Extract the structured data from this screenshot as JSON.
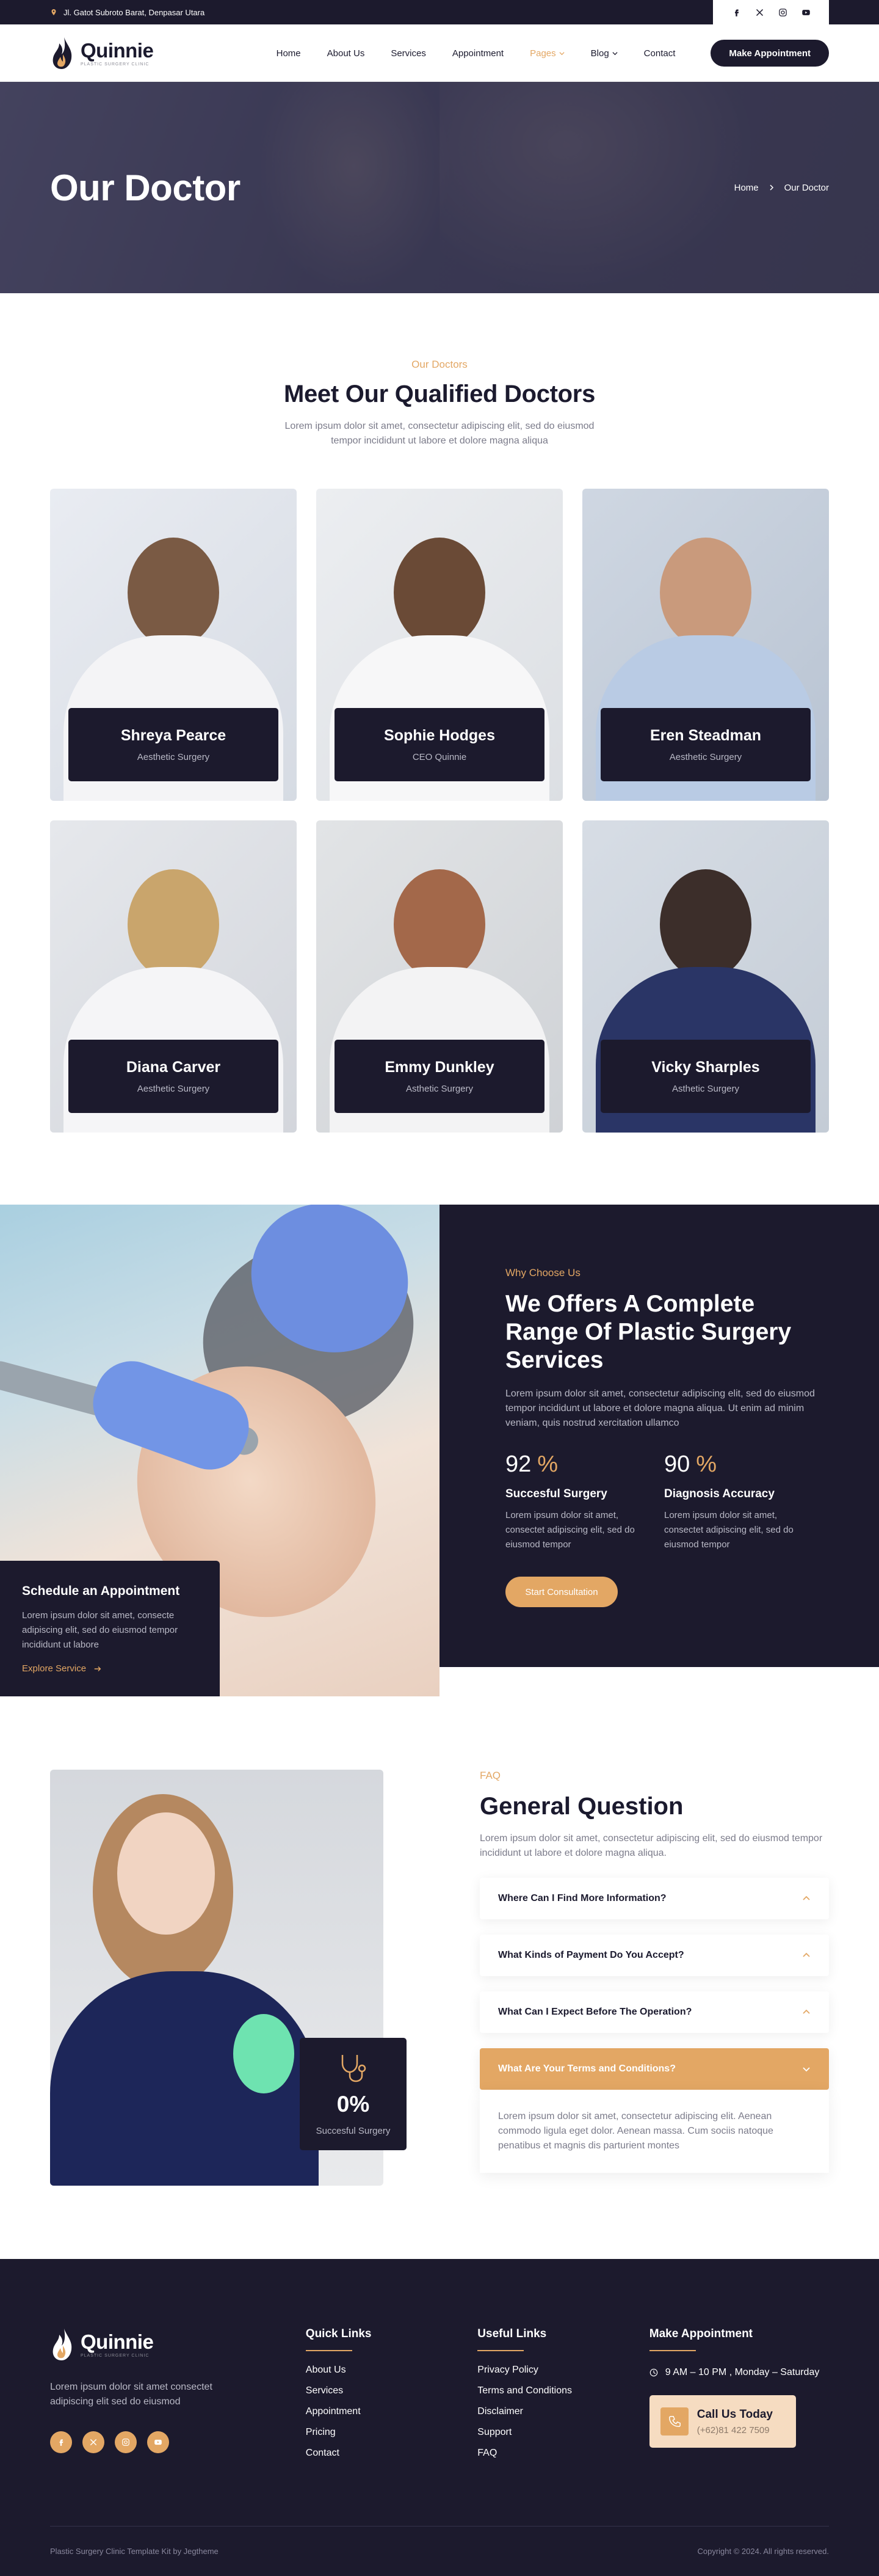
{
  "topbar": {
    "address": "Jl. Gatot Subroto Barat, Denpasar Utara"
  },
  "brand": {
    "name": "Quinnie",
    "tagline": "Plastic Surgery Clinic"
  },
  "nav": {
    "items": [
      {
        "label": "Home"
      },
      {
        "label": "About Us"
      },
      {
        "label": "Services"
      },
      {
        "label": "Appointment"
      },
      {
        "label": "Pages"
      },
      {
        "label": "Blog"
      },
      {
        "label": "Contact"
      }
    ],
    "cta": "Make Appointment"
  },
  "hero": {
    "title": "Our Doctor",
    "breadcrumb": {
      "home": "Home",
      "current": "Our Doctor"
    }
  },
  "doctors": {
    "eyebrow": "Our Doctors",
    "title": "Meet Our Qualified Doctors",
    "description": "Lorem ipsum dolor sit amet, consectetur adipiscing elit, sed do eiusmod tempor incididunt ut labore et dolore magna aliqua",
    "list": [
      {
        "name": "Shreya Pearce",
        "role": "Aesthetic Surgery"
      },
      {
        "name": "Sophie Hodges",
        "role": "CEO Quinnie"
      },
      {
        "name": "Eren Steadman",
        "role": "Aesthetic Surgery"
      },
      {
        "name": "Diana Carver",
        "role": "Aesthetic Surgery"
      },
      {
        "name": "Emmy Dunkley",
        "role": "Asthetic Surgery"
      },
      {
        "name": "Vicky Sharples",
        "role": "Asthetic Surgery"
      }
    ]
  },
  "why": {
    "eyebrow": "Why Choose Us",
    "title": "We Offers A Complete Range Of Plastic Surgery Services",
    "description": "Lorem ipsum dolor sit amet, consectetur adipiscing elit, sed do eiusmod tempor incididunt ut labore et dolore magna aliqua. Ut enim ad minim veniam, quis nostrud xercitation ullamco",
    "stats": [
      {
        "value": "92",
        "unit": "%",
        "title": "Succesful Surgery",
        "text": "Lorem ipsum dolor sit amet, consectet adipiscing elit, sed do eiusmod tempor"
      },
      {
        "value": "90",
        "unit": "%",
        "title": "Diagnosis Accuracy",
        "text": "Lorem ipsum dolor sit amet, consectet adipiscing elit, sed do eiusmod tempor"
      }
    ],
    "button": "Start Consultation",
    "schedule": {
      "title": "Schedule an Appointment",
      "text": "Lorem ipsum dolor sit amet, consecte adipiscing elit, sed do eiusmod tempor incididunt ut labore",
      "link": "Explore Service"
    }
  },
  "faq": {
    "eyebrow": "FAQ",
    "title": "General Question",
    "description": "Lorem ipsum dolor sit amet, consectetur adipiscing elit, sed do eiusmod tempor incididunt ut labore et dolore magna aliqua.",
    "badge": {
      "value": "0%",
      "label": "Succesful Surgery"
    },
    "questions": [
      {
        "q": "Where Can I Find More Information?"
      },
      {
        "q": "What Kinds of Payment Do You Accept?"
      },
      {
        "q": "What Can I Expect Before The Operation?"
      },
      {
        "q": "What Are Your Terms and Conditions?"
      }
    ],
    "answer": "Lorem ipsum dolor sit amet, consectetur adipiscing elit. Aenean commodo ligula eget dolor. Aenean massa. Cum sociis natoque penatibus et magnis dis parturient montes"
  },
  "footer": {
    "about": "Lorem ipsum dolor sit amet consectet adipiscing elit sed do eiusmod",
    "quick_links": {
      "title": "Quick Links",
      "items": [
        "About Us",
        "Services",
        "Appointment",
        "Pricing",
        "Contact"
      ]
    },
    "useful_links": {
      "title": "Useful Links",
      "items": [
        "Privacy Policy",
        "Terms and Conditions",
        "Disclaimer",
        "Support",
        "FAQ"
      ]
    },
    "appointment": {
      "title": "Make Appointment",
      "hours": "9 AM – 10 PM , Monday – Saturday",
      "call_title": "Call Us Today",
      "phone": "(+62)81 422 7509"
    },
    "credit": "Plastic Surgery Clinic Template Kit by Jegtheme",
    "copyright": "Copyright © 2024. All rights reserved."
  },
  "colors": {
    "navy": "#1c1a2d",
    "gold": "#e3a764"
  }
}
